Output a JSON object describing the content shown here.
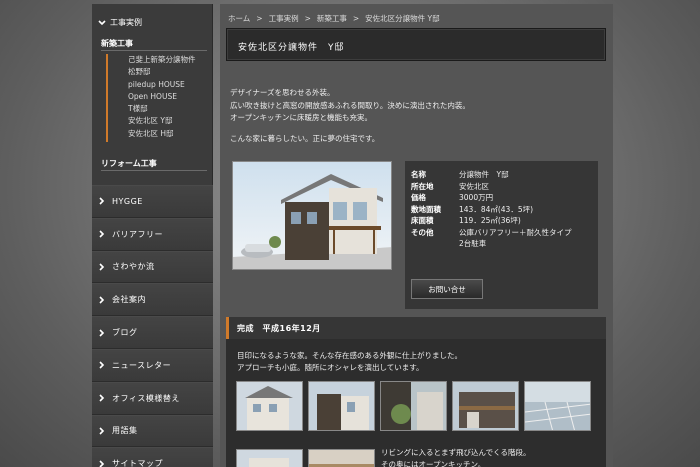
{
  "sidebar": {
    "section_title": "工事実例",
    "new_title": "新築工事",
    "works": [
      "己斐上新築分譲物件",
      "松野邸",
      "piledup HOUSE",
      "Open HOUSE",
      "T様邸",
      "安佐北区 Y邸",
      "安佐北区 H邸"
    ],
    "reform_title": "リフォーム工事",
    "nav": [
      "HYGGE",
      "バリアフリー",
      "さわやか流",
      "会社案内",
      "ブログ",
      "ニュースレター",
      "オフィス模様替え",
      "用語集",
      "サイトマップ"
    ]
  },
  "breadcrumb": [
    "ホーム",
    ">",
    "工事実例",
    ">",
    "新築工事",
    ">",
    "安佐北区分譲物件 Y邸"
  ],
  "page_title": "安佐北区分譲物件　Y邸",
  "intro": {
    "lines": [
      "デザイナーズを思わせる外装。",
      "広い吹き抜けと高窓の開放感あふれる間取り。決めに演出された内装。",
      "オープンキッチンに床暖房と機能も充実。"
    ],
    "closing": "こんな家に暮らしたい。正に夢の住宅です。"
  },
  "spec": {
    "rows": [
      {
        "k": "名称",
        "v": "分譲物件　Y邸"
      },
      {
        "k": "所在地",
        "v": "安佐北区"
      },
      {
        "k": "価格",
        "v": "3000万円"
      },
      {
        "k": "敷地面積",
        "v": "143．84㎡(43．5坪)"
      },
      {
        "k": "床面積",
        "v": "119．25㎡(36坪)"
      },
      {
        "k": "その他",
        "v": "公庫バリアフリー＋耐久性タイプ"
      },
      {
        "k": "",
        "v": "2台駐車"
      }
    ],
    "inquiry_label": "お問い合せ"
  },
  "completion": {
    "title": "完成　平成16年12月",
    "lines": [
      "目印になるような家。そんな存在感のある外観に仕上がりました。",
      "アプローチも小庭。随所にオシャレを演出しています。"
    ],
    "lines2": [
      "リビングに入るとまず飛び込んでくる階段。",
      "その奥にはオープンキッチン。"
    ]
  },
  "colors": {
    "accent": "#d07a2a",
    "panel": "#363636",
    "main_bg": "#555555"
  }
}
